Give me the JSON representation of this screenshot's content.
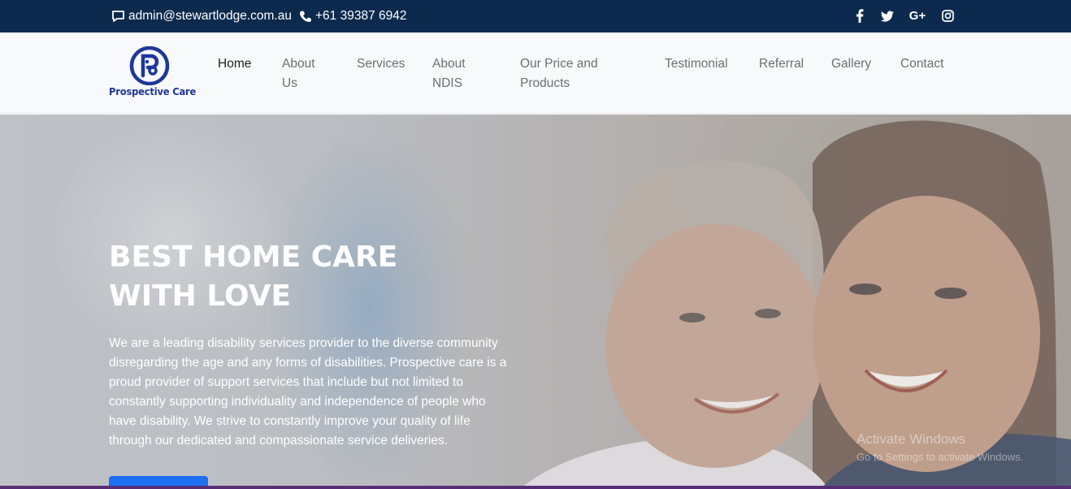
{
  "topbar": {
    "email": "admin@stewartlodge.com.au",
    "phone": "+61 39387 6942",
    "social": [
      {
        "icon": "facebook-icon",
        "glyph": "f"
      },
      {
        "icon": "twitter-icon",
        "glyph": ""
      },
      {
        "icon": "google-plus-icon",
        "glyph": "G+"
      },
      {
        "icon": "instagram-icon",
        "glyph": ""
      }
    ]
  },
  "brand": {
    "name": "Prospective Care",
    "color": "#1e3799"
  },
  "nav": {
    "items": [
      {
        "label": "Home",
        "line2": ""
      },
      {
        "label": "About",
        "line2": "Us"
      },
      {
        "label": "Services",
        "line2": ""
      },
      {
        "label": "About",
        "line2": "NDIS"
      },
      {
        "label": "Our Price and",
        "line2": "Products"
      },
      {
        "label": "Testimonial",
        "line2": ""
      },
      {
        "label": "Referral",
        "line2": ""
      },
      {
        "label": "Gallery",
        "line2": ""
      },
      {
        "label": "Contact",
        "line2": ""
      }
    ],
    "active_index": 0
  },
  "hero": {
    "title_line1": "BEST HOME CARE",
    "title_line2": "WITH LOVE",
    "body_lines": [
      "We are a leading disability services provider to the diverse community",
      "disregarding the age and any forms of disabilities. Prospective care is a",
      "proud provider of support services that include but not limited to",
      "constantly supporting individuality and independence of people who",
      "have disability. We strive to constantly improve your quality of life",
      "through our dedicated and compassionate service deliveries."
    ],
    "cta_color": "#1c6ff2"
  },
  "watermark": {
    "line1": "Activate Windows",
    "line2": "Go to Settings to activate Windows."
  },
  "colors": {
    "topbar": "#0b2a4d",
    "nav_bg": "#f8f9fb"
  }
}
